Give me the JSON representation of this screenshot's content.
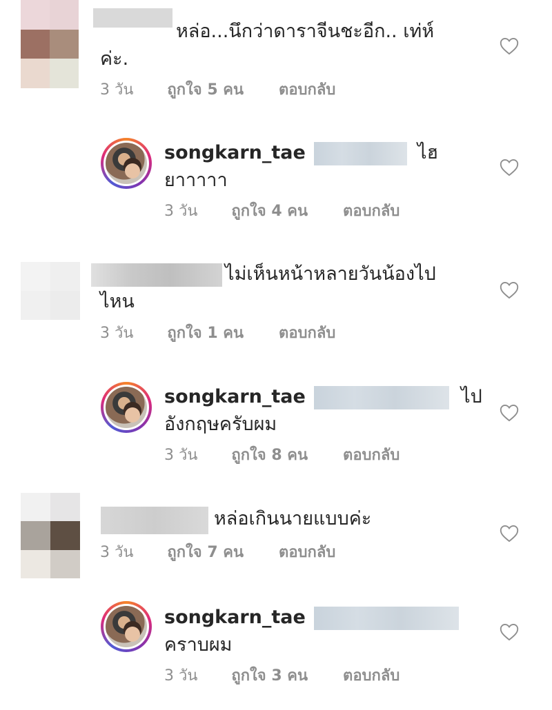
{
  "comments": [
    {
      "user": "",
      "text_line1": "หล่อ...นึกว่าดาราจีนชะอีก.. เท่ห์",
      "text_line2": "ค่ะ.",
      "time": "3 วัน",
      "likes": "ถูกใจ 5 คน",
      "reply": "ตอบกลับ"
    },
    {
      "user": "songkarn_tae",
      "text_line1": "ไฮ",
      "text_line2": "ยาาาาา",
      "time": "3 วัน",
      "likes": "ถูกใจ 4 คน",
      "reply": "ตอบกลับ"
    },
    {
      "user": "",
      "text_line1": "ไม่เห็นหน้าหลายวันน้องไป",
      "text_line2": "ไหน",
      "time": "3 วัน",
      "likes": "ถูกใจ 1 คน",
      "reply": "ตอบกลับ"
    },
    {
      "user": "songkarn_tae",
      "text_line1": "ไป",
      "text_line2": "อังกฤษครับผม",
      "time": "3 วัน",
      "likes": "ถูกใจ 8 คน",
      "reply": "ตอบกลับ"
    },
    {
      "user": "",
      "text_line1": "หล่อเกินนายแบบค่ะ",
      "text_line2": "",
      "time": "3 วัน",
      "likes": "ถูกใจ 7 คน",
      "reply": "ตอบกลับ"
    },
    {
      "user": "songkarn_tae",
      "text_line1": "",
      "text_line2": "คราบผม",
      "time": "3 วัน",
      "likes": "ถูกใจ 3 คน",
      "reply": "ตอบกลับ"
    }
  ],
  "icons": {
    "like": "heart-outline-icon"
  },
  "colors": {
    "text": "#262626",
    "meta": "#8e8e8e",
    "heart": "#8e8e8e"
  }
}
